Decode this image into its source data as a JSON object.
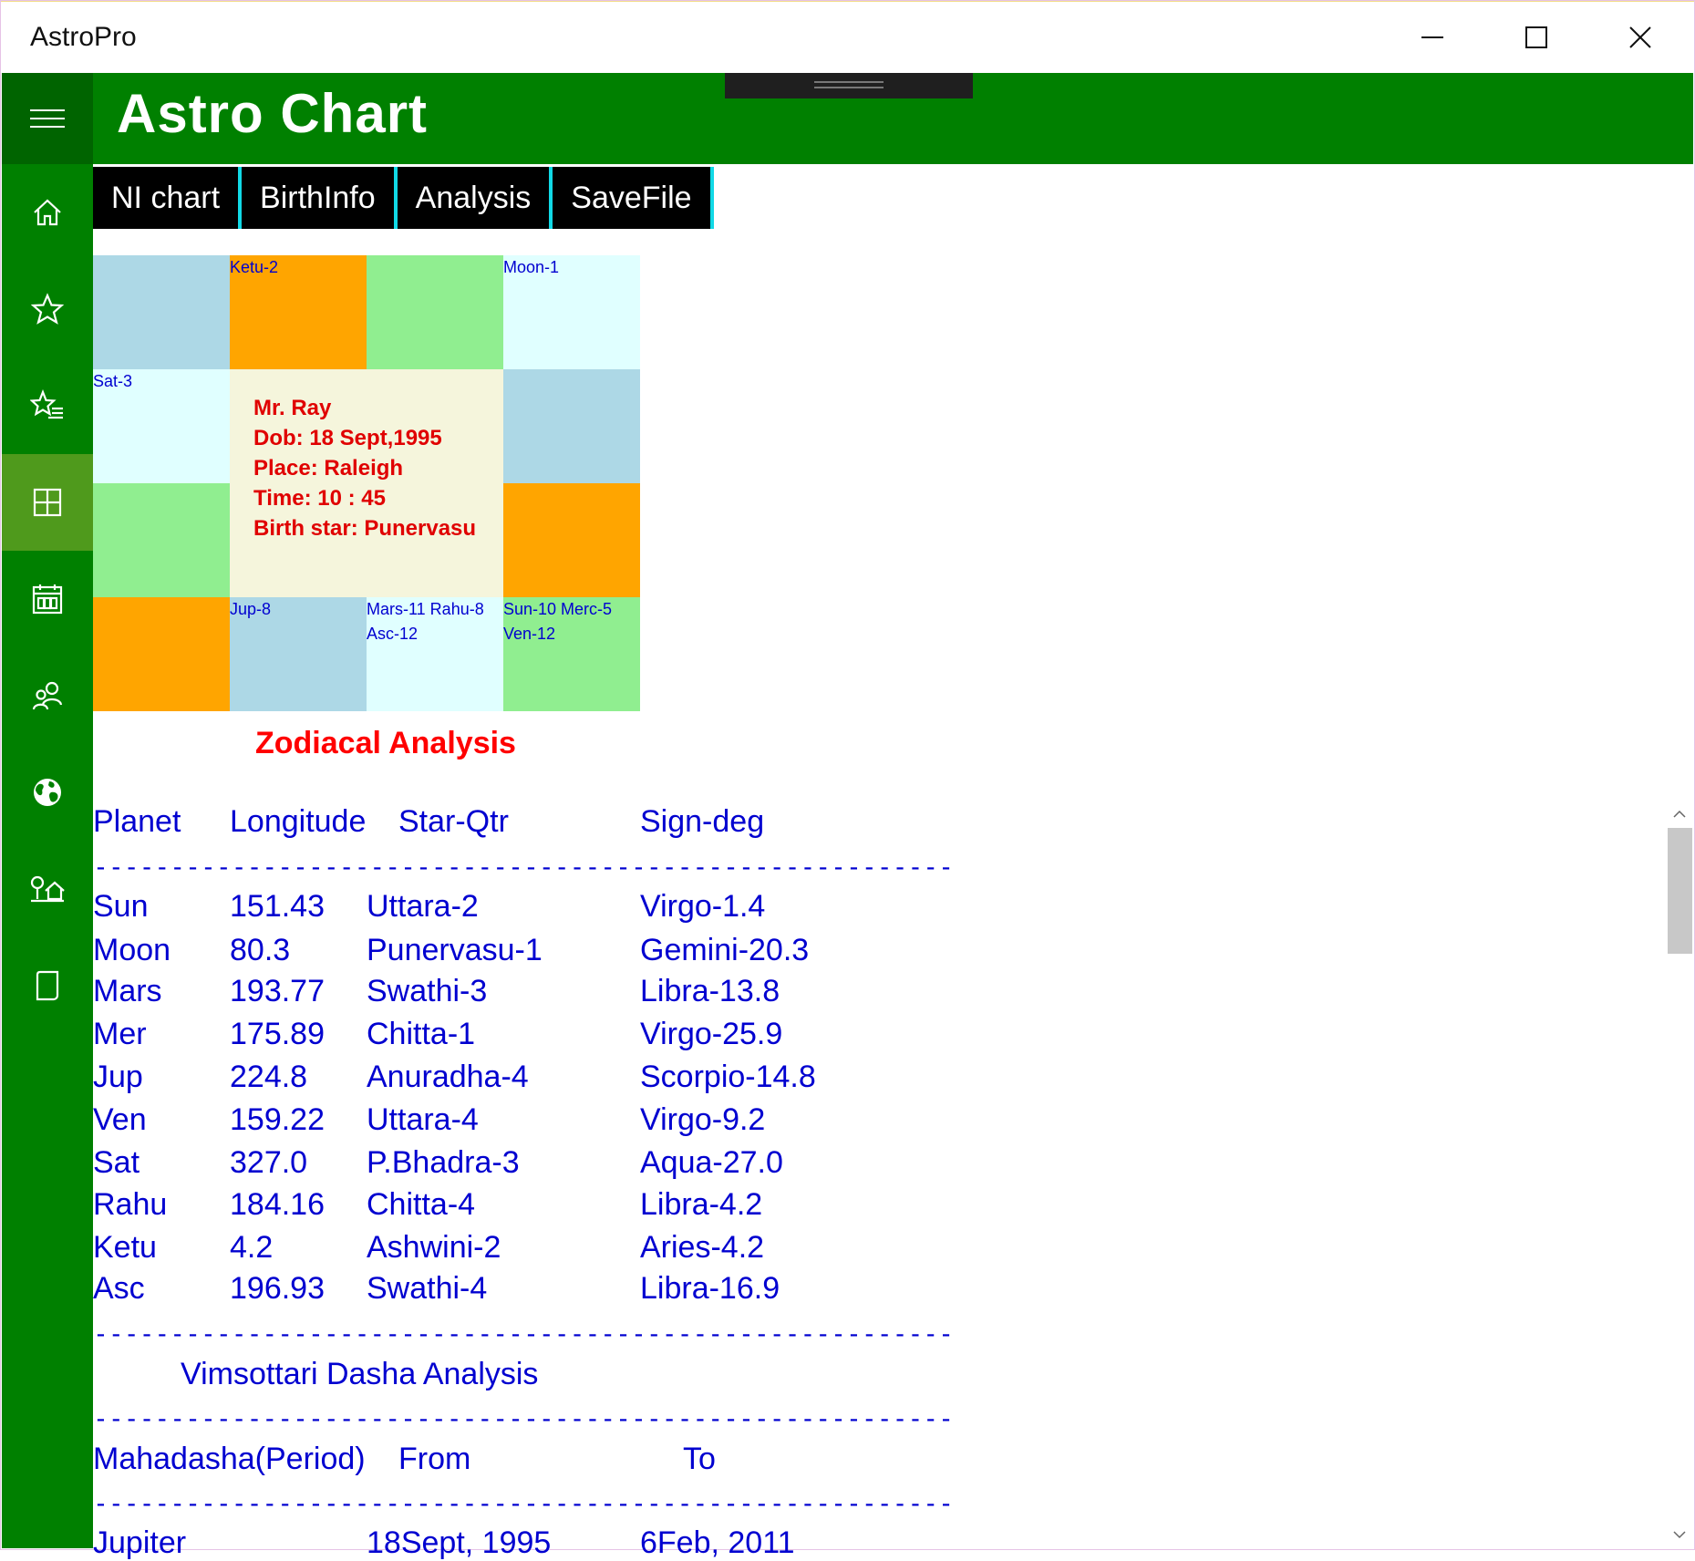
{
  "window": {
    "app_title": "AstroPro"
  },
  "header": {
    "title": "Astro Chart"
  },
  "tabs": [
    {
      "label": "NI chart"
    },
    {
      "label": "BirthInfo"
    },
    {
      "label": "Analysis"
    },
    {
      "label": "SaveFile"
    }
  ],
  "sidebar": {
    "items": [
      {
        "icon": "home-icon"
      },
      {
        "icon": "star-icon"
      },
      {
        "icon": "star-list-icon"
      },
      {
        "icon": "grid-icon",
        "active": true
      },
      {
        "icon": "calendar-icon"
      },
      {
        "icon": "people-icon"
      },
      {
        "icon": "globe-icon"
      },
      {
        "icon": "tree-house-icon"
      },
      {
        "icon": "tablet-icon"
      }
    ]
  },
  "chart": {
    "cells": {
      "r0c1": [
        "Ketu-2"
      ],
      "r0c3": [
        "Moon-1"
      ],
      "r1c0": [
        "Sat-3"
      ],
      "r3c1": [
        "Jup-8"
      ],
      "r3c2": [
        "Mars-11 Rahu-8",
        "Asc-12"
      ],
      "r3c3": [
        "Sun-10 Merc-5",
        "Ven-12"
      ]
    },
    "center": {
      "name": "Mr. Ray",
      "dob": "Dob: 18 Sept,1995",
      "place": "Place: Raleigh",
      "time": "Time: 10 : 45",
      "star": "Birth star: Punervasu"
    },
    "colors": {
      "lightblue": "#add8e6",
      "orange": "#ffa500",
      "lightgreen": "#90ee90",
      "lightcyan": "#e0ffff",
      "beige": "#f5f5dc"
    }
  },
  "zodiacal": {
    "title": "Zodiacal Analysis",
    "headers": [
      "Planet",
      "Longitude",
      "Star-Qtr",
      "Sign-deg"
    ],
    "rows": [
      [
        "Sun",
        "151.43",
        "Uttara-2",
        "Virgo-1.4"
      ],
      [
        "Moon",
        "80.3",
        "Punervasu-1",
        "Gemini-20.3"
      ],
      [
        "Mars",
        "193.77",
        "Swathi-3",
        "Libra-13.8"
      ],
      [
        "Mer",
        "175.89",
        "Chitta-1",
        "Virgo-25.9"
      ],
      [
        "Jup",
        "224.8",
        "Anuradha-4",
        "Scorpio-14.8"
      ],
      [
        "Ven",
        "159.22",
        "Uttara-4",
        "Virgo-9.2"
      ],
      [
        "Sat",
        "327.0",
        "P.Bhadra-3",
        "Aqua-27.0"
      ],
      [
        "Rahu",
        "184.16",
        "Chitta-4",
        "Libra-4.2"
      ],
      [
        "Ketu",
        "4.2",
        "Ashwini-2",
        "Aries-4.2"
      ],
      [
        "Asc",
        "196.93",
        "Swathi-4",
        "Libra-16.9"
      ]
    ],
    "divider": "--------------------------------------------------------"
  },
  "dasha": {
    "title": "Vimsottari Dasha Analysis",
    "headers": [
      "Mahadasha(Period)",
      "From",
      "To"
    ],
    "first_row": [
      "Jupiter",
      "18Sept, 1995",
      "6Feb, 2011"
    ]
  }
}
